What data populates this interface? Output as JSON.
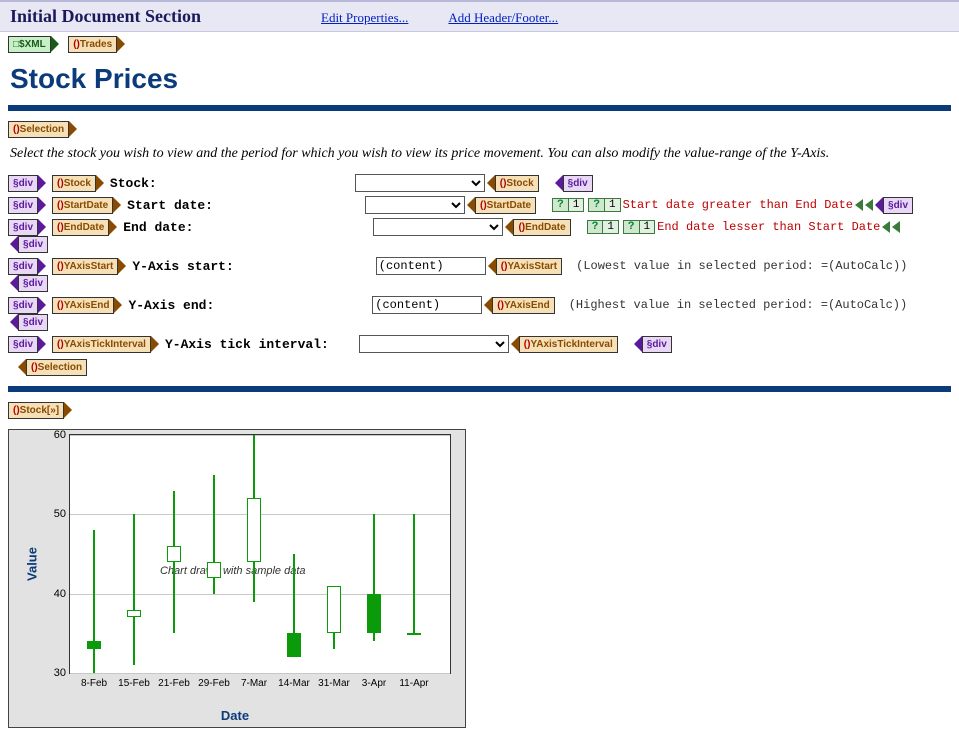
{
  "header": {
    "title": "Initial Document Section",
    "links": {
      "edit": "Edit Properties...",
      "addhf": "Add Header/Footer..."
    }
  },
  "tags": {
    "xml": "$XML",
    "trades": "Trades",
    "selection": "Selection",
    "stockIter": "Stock[»]",
    "div": "div"
  },
  "page_title": "Stock Prices",
  "intro": "Select the stock you wish to view and the period for which you wish to view its price movement. You can also modify the value-range of the Y-Axis.",
  "rows": {
    "stock": {
      "label": "Stock:",
      "elem": "Stock"
    },
    "startdate": {
      "label": "Start date:",
      "elem": "StartDate",
      "err": "Start date greater than End Date"
    },
    "enddate": {
      "label": "End date:",
      "elem": "EndDate",
      "err": "End date lesser than Start Date"
    },
    "yaxisstart": {
      "label": "Y-Axis start:",
      "elem": "YAxisStart",
      "val": "(content)",
      "hint": "(Lowest value in selected period: =(AutoCalc))"
    },
    "yaxisend": {
      "label": "Y-Axis end:",
      "elem": "YAxisEnd",
      "val": "(content)",
      "hint": "(Highest value in selected period: =(AutoCalc))"
    },
    "ytick": {
      "label": "Y-Axis tick interval:",
      "elem": "YAxisTickInterval"
    }
  },
  "cond": {
    "q": "?",
    "one": "1"
  },
  "chart_data": {
    "type": "candlestick",
    "title": "",
    "xlabel": "Date",
    "ylabel": "Value",
    "ylim": [
      30,
      60
    ],
    "yticks": [
      30,
      40,
      50,
      60
    ],
    "categories": [
      "8-Feb",
      "15-Feb",
      "21-Feb",
      "29-Feb",
      "7-Mar",
      "14-Mar",
      "31-Mar",
      "3-Apr",
      "11-Apr"
    ],
    "series": [
      {
        "open": 33,
        "close": 34,
        "low": 30,
        "high": 48,
        "fill": true
      },
      {
        "open": 37,
        "close": 38,
        "low": 31,
        "high": 50,
        "fill": false
      },
      {
        "open": 44,
        "close": 46,
        "low": 35,
        "high": 53,
        "fill": false
      },
      {
        "open": 42,
        "close": 44,
        "low": 40,
        "high": 55,
        "fill": false
      },
      {
        "open": 44,
        "close": 52,
        "low": 39,
        "high": 60,
        "fill": false
      },
      {
        "open": 32,
        "close": 35,
        "low": 32,
        "high": 45,
        "fill": true
      },
      {
        "open": 35,
        "close": 41,
        "low": 33,
        "high": 41,
        "fill": false
      },
      {
        "open": 35,
        "close": 40,
        "low": 34,
        "high": 50,
        "fill": true
      },
      {
        "open": 35,
        "close": 35,
        "low": 35,
        "high": 50,
        "fill": true
      }
    ],
    "annotation": "Chart drawn with sample data"
  }
}
